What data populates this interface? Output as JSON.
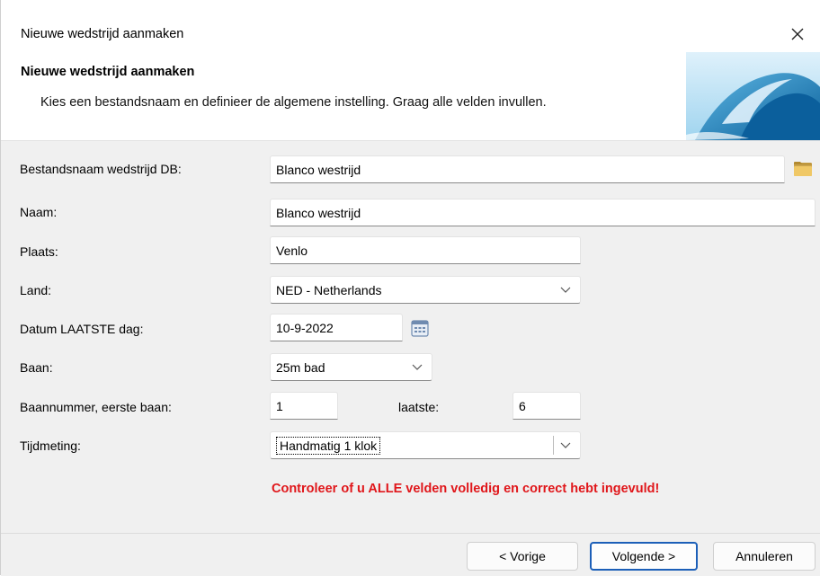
{
  "window": {
    "title": "Nieuwe wedstrijd aanmaken"
  },
  "header": {
    "title": "Nieuwe wedstrijd aanmaken",
    "description": "Kies een bestandsnaam en definieer de algemene instelling. Graag alle velden invullen."
  },
  "form": {
    "filename": {
      "label": "Bestandsnaam wedstrijd DB:",
      "value": "Blanco westrijd"
    },
    "name": {
      "label": "Naam:",
      "value": "Blanco westrijd"
    },
    "place": {
      "label": "Plaats:",
      "value": "Venlo"
    },
    "country": {
      "label": "Land:",
      "value": "NED - Netherlands"
    },
    "date": {
      "label": "Datum LAATSTE dag:",
      "value": "10-9-2022"
    },
    "pool": {
      "label": "Baan:",
      "value": "25m bad"
    },
    "lanes": {
      "label": "Baannummer, eerste baan:",
      "first": "1",
      "last_label": "laatste:",
      "last": "6"
    },
    "timing": {
      "label": "Tijdmeting:",
      "value": "Handmatig 1 klok"
    }
  },
  "warning": "Controleer of u ALLE velden volledig en correct hebt ingevuld!",
  "buttons": {
    "prev": "< Vorige",
    "next": "Volgende >",
    "cancel": "Annuleren"
  },
  "colors": {
    "warning": "#e0161a",
    "primary_border": "#1c5fb8",
    "body_bg": "#f0f0f0"
  }
}
